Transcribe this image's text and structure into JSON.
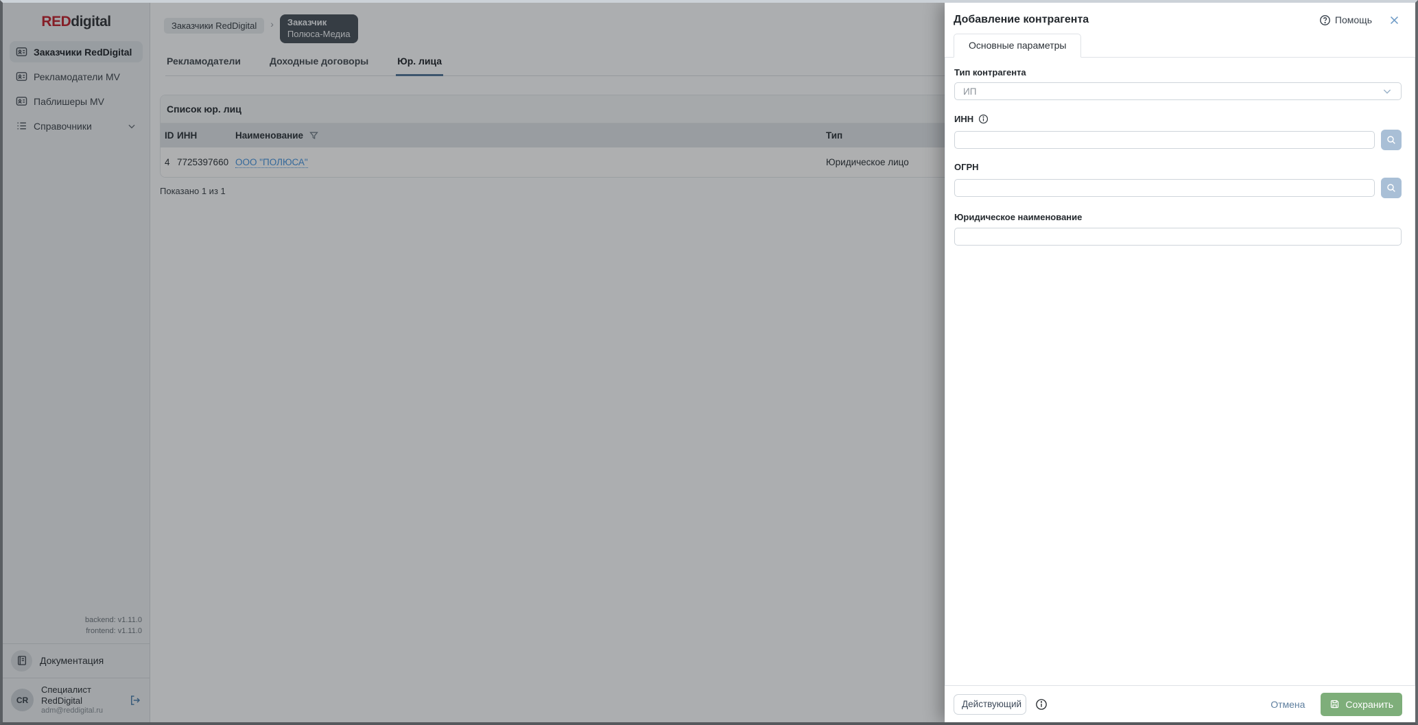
{
  "app": {
    "logo_red": "RED",
    "logo_rest": "digital"
  },
  "sidebar": {
    "items": [
      {
        "label": "Заказчики RedDigital",
        "active": true
      },
      {
        "label": "Рекламодатели MV",
        "active": false
      },
      {
        "label": "Паблишеры MV",
        "active": false
      },
      {
        "label": "Справочники",
        "active": false
      }
    ],
    "versions": {
      "backend": "backend: v1.11.0",
      "frontend": "frontend: v1.11.0"
    },
    "docs_label": "Документация",
    "user": {
      "initials": "CR",
      "name_line1": "Специалист",
      "name_line2": "RedDigital",
      "email": "adm@reddigital.ru"
    }
  },
  "breadcrumb": {
    "root": "Заказчики RedDigital",
    "separator": "›",
    "current_type": "Заказчик",
    "current_name": "Полюса-Медиа"
  },
  "tabs": [
    {
      "label": "Рекламодатели"
    },
    {
      "label": "Доходные договоры"
    },
    {
      "label": "Юр. лица"
    }
  ],
  "table": {
    "card_title": "Список юр. лиц",
    "columns": {
      "id": "ID",
      "inn": "ИНН",
      "name": "Наименование",
      "type": "Тип"
    },
    "rows": [
      {
        "id": "4",
        "inn": "7725397660",
        "name": "ООО \"ПОЛЮСА\"",
        "type": "Юридическое лицо"
      }
    ],
    "footer_note": "Показано 1 из 1"
  },
  "drawer": {
    "title": "Добавление контрагента",
    "help_label": "Помощь",
    "tab_label": "Основные параметры",
    "form": {
      "type_label": "Тип контрагента",
      "type_value": "ИП",
      "inn_label": "ИНН",
      "inn_value": "",
      "ogrn_label": "ОГРН",
      "ogrn_value": "",
      "name_label": "Юридическое наименование",
      "name_value": ""
    },
    "footer": {
      "status_value": "Действующий",
      "cancel_label": "Отмена",
      "save_label": "Сохранить"
    }
  },
  "colors": {
    "logo_red": "#bf2430",
    "tab_underline": "#527699",
    "link_blue": "#4693dc",
    "search_button": "#a9bfd6",
    "save_green": "#7eae7a",
    "tooltip_bg": "#49525c",
    "sidebar_bg": "#ebeef0",
    "backdrop": "rgba(14,17,20,0.33)"
  }
}
